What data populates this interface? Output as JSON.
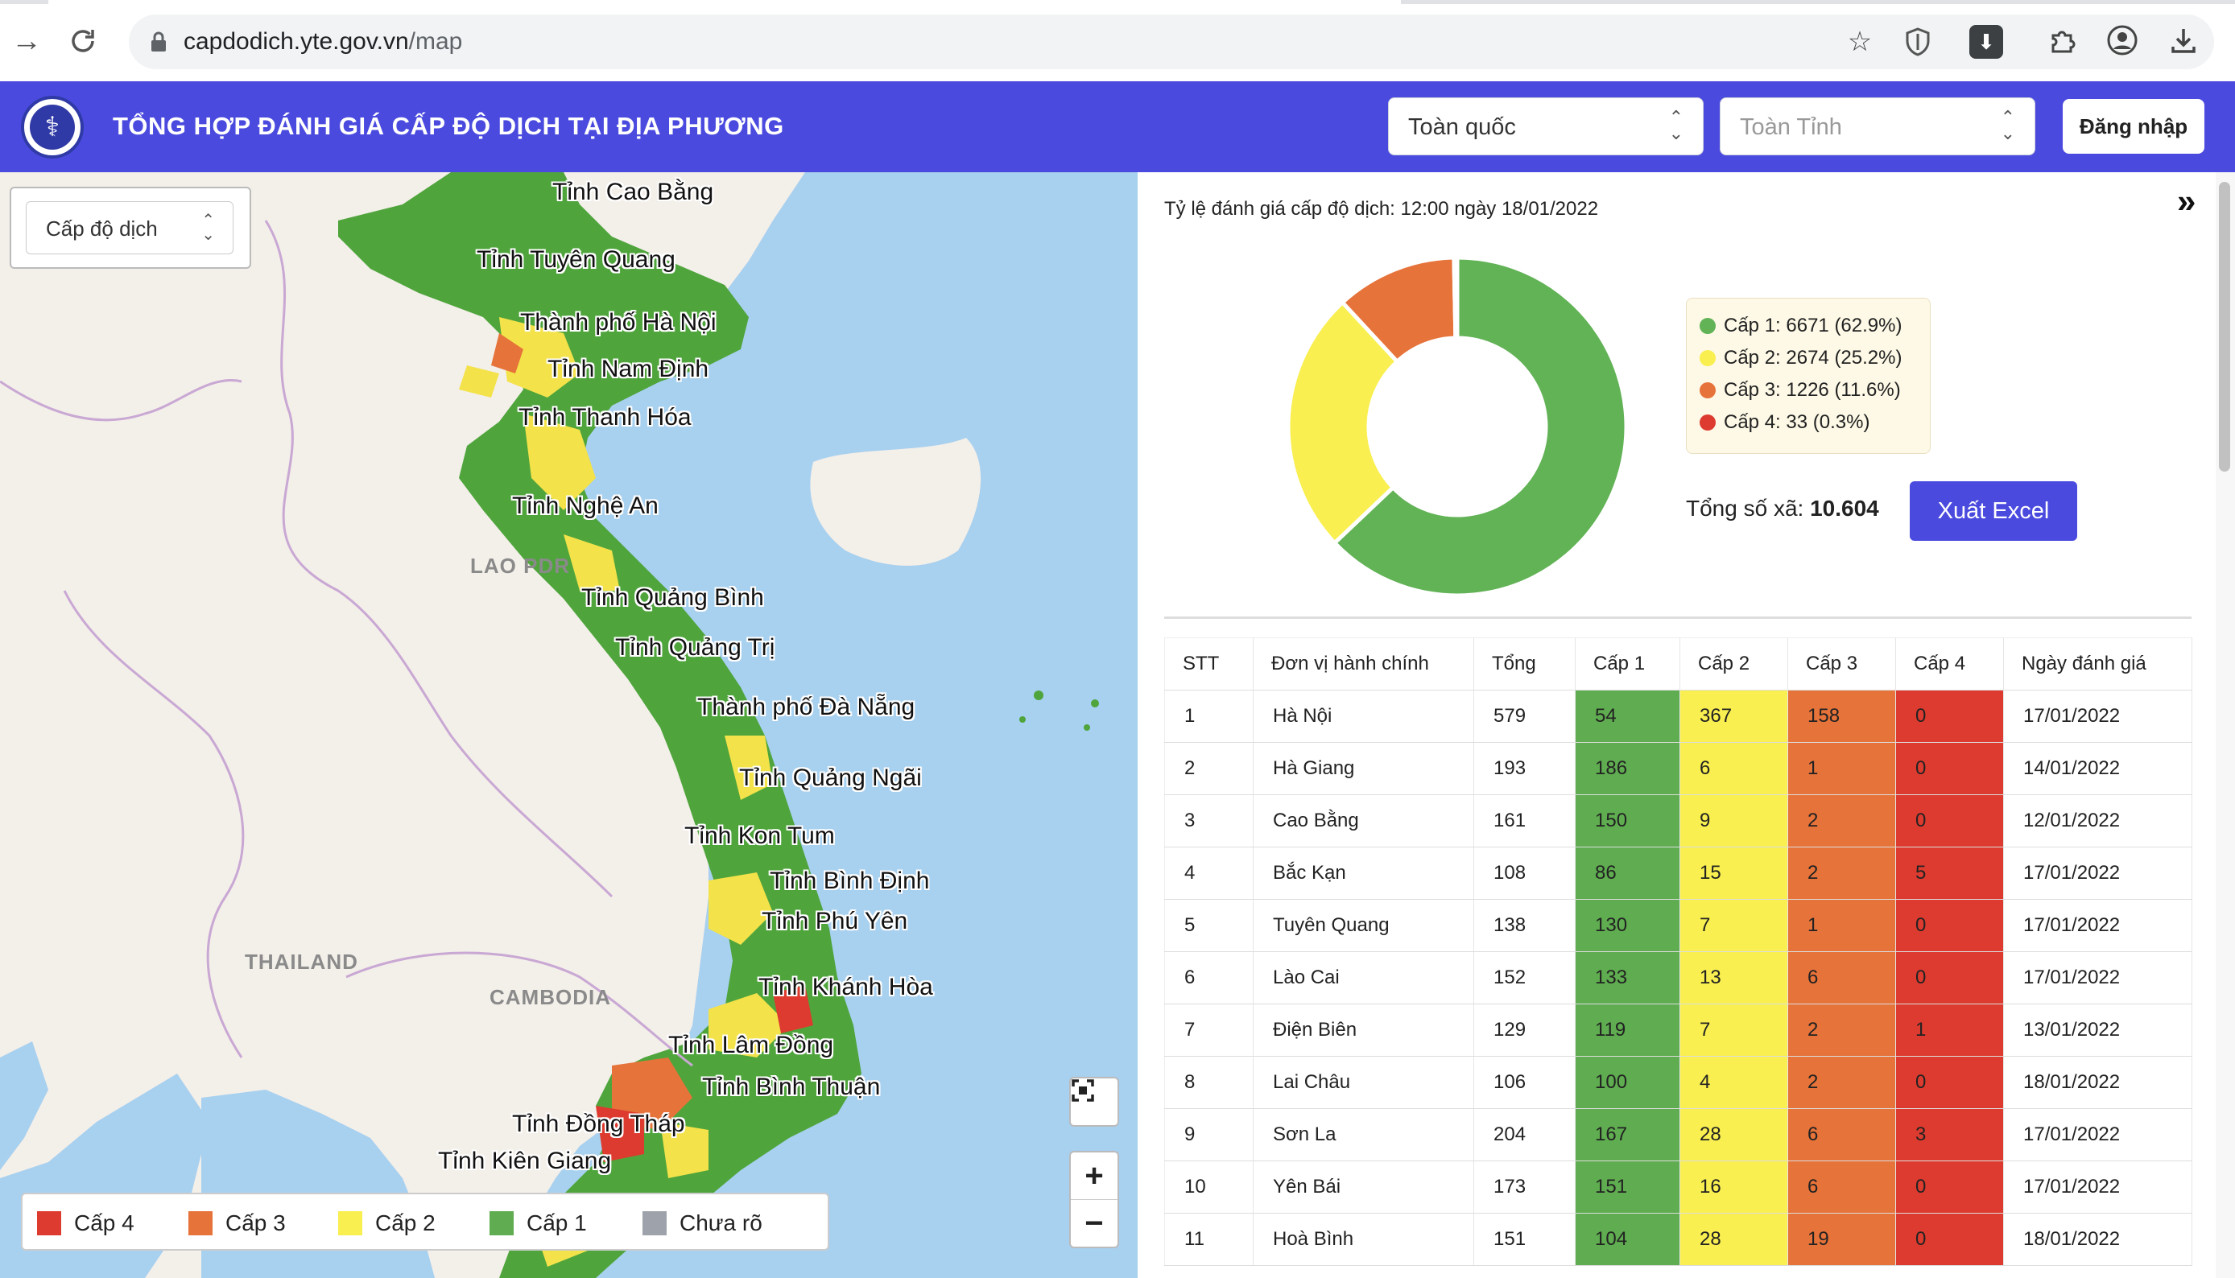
{
  "browser": {
    "url_host": "capdodich.yte.gov.vn",
    "url_path": "/map"
  },
  "header": {
    "title": "TỔNG HỢP ĐÁNH GIÁ CẤP ĐỘ DỊCH TẠI ĐỊA PHƯƠNG",
    "region_select": "Toàn quốc",
    "province_select_placeholder": "Toàn Tỉnh",
    "login_label": "Đăng nhập"
  },
  "map": {
    "layer_select": "Cấp độ dịch",
    "province_labels": [
      "Tỉnh Cao Bằng",
      "Tỉnh Tuyên Quang",
      "Thành phố Hà Nội",
      "Tỉnh Nam Định",
      "Tỉnh Thanh Hóa",
      "Tỉnh Nghệ An",
      "Tỉnh Quảng Bình",
      "Tỉnh Quảng Trị",
      "Thành phố Đà Nẵng",
      "Tỉnh Quảng Ngãi",
      "Tỉnh Kon Tum",
      "Tỉnh Bình Định",
      "Tỉnh Phú Yên",
      "Tỉnh Khánh Hòa",
      "Tỉnh Lâm Đồng",
      "Tỉnh Bình Thuận",
      "Tỉnh Đồng Tháp",
      "Tỉnh Kiên Giang"
    ],
    "country_labels": [
      "LAO PDR",
      "THAILAND",
      "CAMBODIA"
    ],
    "legend": [
      {
        "label": "Cấp 4",
        "color": "#dd3b2f"
      },
      {
        "label": "Cấp 3",
        "color": "#e6733a"
      },
      {
        "label": "Cấp 2",
        "color": "#f9ef50"
      },
      {
        "label": "Cấp 1",
        "color": "#5fad50"
      },
      {
        "label": "Chưa rõ",
        "color": "#9ea3ab"
      }
    ],
    "zoom_in": "+",
    "zoom_out": "−"
  },
  "summary": {
    "rate_title": "Tỷ lệ đánh giá cấp độ dịch: 12:00 ngày 18/01/2022",
    "total_label": "Tổng số xã:",
    "total_value": "10.604",
    "export_label": "Xuất Excel"
  },
  "chart_data": {
    "type": "pie",
    "categories": [
      "Cấp 1",
      "Cấp 2",
      "Cấp 3",
      "Cấp 4"
    ],
    "values": [
      6671,
      2674,
      1226,
      33
    ],
    "percents": [
      62.9,
      25.2,
      11.6,
      0.3
    ],
    "colors": [
      "#62b256",
      "#f9ef50",
      "#e6733a",
      "#dd3b2f"
    ],
    "legend_labels": [
      "Cấp 1: 6671 (62.9%)",
      "Cấp 2: 2674 (25.2%)",
      "Cấp 3: 1226 (11.6%)",
      "Cấp 4: 33 (0.3%)"
    ],
    "title": ""
  },
  "table": {
    "headers": [
      "STT",
      "Đơn vị hành chính",
      "Tổng",
      "Cấp 1",
      "Cấp 2",
      "Cấp 3",
      "Cấp 4",
      "Ngày đánh giá"
    ],
    "rows": [
      [
        "1",
        "Hà Nội",
        "579",
        "54",
        "367",
        "158",
        "0",
        "17/01/2022"
      ],
      [
        "2",
        "Hà Giang",
        "193",
        "186",
        "6",
        "1",
        "0",
        "14/01/2022"
      ],
      [
        "3",
        "Cao Bằng",
        "161",
        "150",
        "9",
        "2",
        "0",
        "12/01/2022"
      ],
      [
        "4",
        "Bắc Kạn",
        "108",
        "86",
        "15",
        "2",
        "5",
        "17/01/2022"
      ],
      [
        "5",
        "Tuyên Quang",
        "138",
        "130",
        "7",
        "1",
        "0",
        "17/01/2022"
      ],
      [
        "6",
        "Lào Cai",
        "152",
        "133",
        "13",
        "6",
        "0",
        "17/01/2022"
      ],
      [
        "7",
        "Điện Biên",
        "129",
        "119",
        "7",
        "2",
        "1",
        "13/01/2022"
      ],
      [
        "8",
        "Lai Châu",
        "106",
        "100",
        "4",
        "2",
        "0",
        "18/01/2022"
      ],
      [
        "9",
        "Sơn La",
        "204",
        "167",
        "28",
        "6",
        "3",
        "17/01/2022"
      ],
      [
        "10",
        "Yên Bái",
        "173",
        "151",
        "16",
        "6",
        "0",
        "17/01/2022"
      ],
      [
        "11",
        "Hoà Bình",
        "151",
        "104",
        "28",
        "19",
        "0",
        "18/01/2022"
      ]
    ]
  }
}
